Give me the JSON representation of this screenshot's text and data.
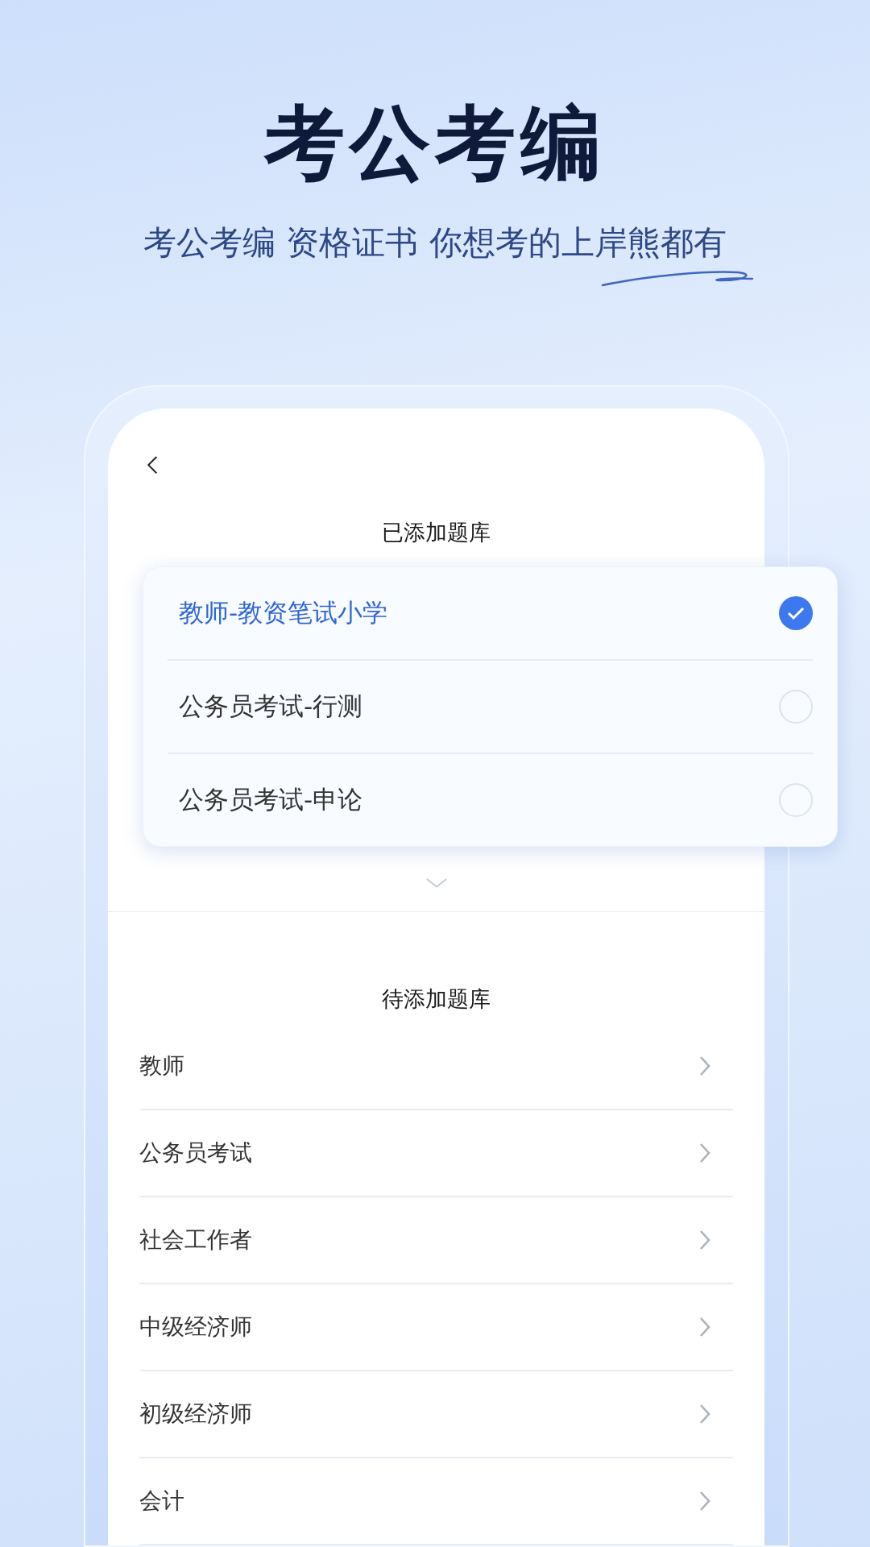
{
  "hero": {
    "title": "考公考编",
    "subtitle": "考公考编 资格证书 你想考的上岸熊都有"
  },
  "screen": {
    "added_heading": "已添加题库",
    "added": [
      {
        "label": "教师-教资笔试小学",
        "selected": true
      },
      {
        "label": "公务员考试-行测",
        "selected": false
      },
      {
        "label": "公务员考试-申论",
        "selected": false
      }
    ],
    "pending_heading": "待添加题库",
    "pending": [
      {
        "label": "教师"
      },
      {
        "label": "公务员考试"
      },
      {
        "label": "社会工作者"
      },
      {
        "label": "中级经济师"
      },
      {
        "label": "初级经济师"
      },
      {
        "label": "会计"
      }
    ]
  }
}
